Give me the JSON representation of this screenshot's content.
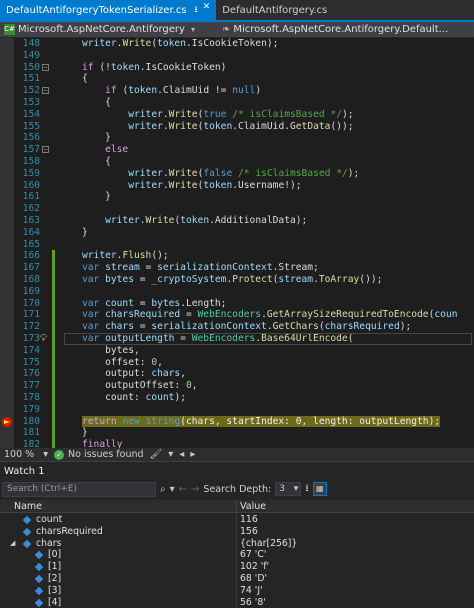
{
  "tabs": [
    {
      "label": "DefaultAntiforgeryTokenSerializer.cs",
      "active": true
    },
    {
      "label": "DefaultAntiforgery.cs",
      "active": false
    }
  ],
  "nav": {
    "project": "Microsoft.AspNetCore.Antiforgery",
    "type": "Microsoft.AspNetCore.Antiforgery.Default..."
  },
  "code_lines": [
    {
      "n": "148",
      "html": "<span class=\"p\">writer</span>.<span class=\"m\">Write</span>(<span class=\"p\">token</span>.IsCookieToken);",
      "indent": 3
    },
    {
      "n": "149",
      "html": "",
      "indent": 0
    },
    {
      "n": "150",
      "html": "<span class=\"ctl\">if</span> (!<span class=\"p\">token</span>.IsCookieToken)",
      "indent": 3
    },
    {
      "n": "151",
      "html": "{",
      "indent": 3
    },
    {
      "n": "152",
      "html": "<span class=\"ctl\">if</span> (<span class=\"p\">token</span>.ClaimUid != <span class=\"k\">null</span>)",
      "indent": 4
    },
    {
      "n": "153",
      "html": "{",
      "indent": 4
    },
    {
      "n": "154",
      "html": "<span class=\"p\">writer</span>.<span class=\"m\">Write</span>(<span class=\"k\">true</span> <span class=\"c\">/* isClaimsBased */</span>);",
      "indent": 5
    },
    {
      "n": "155",
      "html": "<span class=\"p\">writer</span>.<span class=\"m\">Write</span>(<span class=\"p\">token</span>.ClaimUid.<span class=\"m\">GetData</span>());",
      "indent": 5
    },
    {
      "n": "156",
      "html": "}",
      "indent": 4
    },
    {
      "n": "157",
      "html": "<span class=\"ctl\">else</span>",
      "indent": 4
    },
    {
      "n": "158",
      "html": "{",
      "indent": 4
    },
    {
      "n": "159",
      "html": "<span class=\"p\">writer</span>.<span class=\"m\">Write</span>(<span class=\"k\">false</span> <span class=\"c\">/* isClaimsBased */</span>);",
      "indent": 5
    },
    {
      "n": "160",
      "html": "<span class=\"p\">writer</span>.<span class=\"m\">Write</span>(<span class=\"p\">token</span>.Username!);",
      "indent": 5
    },
    {
      "n": "161",
      "html": "}",
      "indent": 4
    },
    {
      "n": "162",
      "html": "",
      "indent": 0
    },
    {
      "n": "163",
      "html": "<span class=\"p\">writer</span>.<span class=\"m\">Write</span>(<span class=\"p\">token</span>.AdditionalData);",
      "indent": 4
    },
    {
      "n": "164",
      "html": "}",
      "indent": 3
    },
    {
      "n": "165",
      "html": "",
      "indent": 0
    },
    {
      "n": "166",
      "html": "<span class=\"p\">writer</span>.<span class=\"m\">Flush</span>();",
      "indent": 3
    },
    {
      "n": "167",
      "html": "<span class=\"k\">var</span> <span class=\"p\">stream</span> = <span class=\"p\">serializationContext</span>.Stream;",
      "indent": 3
    },
    {
      "n": "168",
      "html": "<span class=\"k\">var</span> <span class=\"p\">bytes</span> = <span class=\"p\">_cryptoSystem</span>.<span class=\"m\">Protect</span>(<span class=\"p\">stream</span>.<span class=\"m\">ToArray</span>());",
      "indent": 3
    },
    {
      "n": "169",
      "html": "",
      "indent": 0
    },
    {
      "n": "170",
      "html": "<span class=\"k\">var</span> <span class=\"p\">count</span> = <span class=\"p\">bytes</span>.Length;",
      "indent": 3
    },
    {
      "n": "171",
      "html": "<span class=\"k\">var</span> <span class=\"p\">charsRequired</span> = <span class=\"t\">WebEncoders</span>.<span class=\"m\">GetArraySizeRequiredToEncode</span>(<span class=\"p\">coun</span>",
      "indent": 3
    },
    {
      "n": "172",
      "html": "<span class=\"k\">var</span> <span class=\"p\">chars</span> = <span class=\"p\">serializationContext</span>.<span class=\"m\">GetChars</span>(<span class=\"p\">charsRequired</span>);",
      "indent": 3
    },
    {
      "n": "173",
      "html": "<span class=\"k\">var</span> <span class=\"p\">outputLength</span> = <span class=\"t\">WebEncoders</span>.<span class=\"m\">Base64UrlEncode</span>(",
      "indent": 3
    },
    {
      "n": "174",
      "html": "bytes,",
      "indent": 4
    },
    {
      "n": "175",
      "html": "offset: <span class=\"n\">0</span>,",
      "indent": 4
    },
    {
      "n": "176",
      "html": "output: <span class=\"p\">chars</span>,",
      "indent": 4
    },
    {
      "n": "177",
      "html": "outputOffset: <span class=\"n\">0</span>,",
      "indent": 4
    },
    {
      "n": "178",
      "html": "count: <span class=\"p\">count</span>);",
      "indent": 4
    },
    {
      "n": "179",
      "html": "",
      "indent": 0
    },
    {
      "n": "180",
      "html": "<span class=\"next-stmt\"><span class=\"ctl\">return</span> <span class=\"k\">new</span> <span class=\"k\">string</span>(chars, startIndex: 0, length: outputLength);</span>",
      "indent": 3
    },
    {
      "n": "181",
      "html": "}",
      "indent": 2
    },
    {
      "n": "182",
      "html": "<span class=\"ctl\">finally</span>",
      "indent": 2
    }
  ],
  "status": {
    "zoom": "100 %",
    "issues": "No issues found"
  },
  "watch": {
    "title": "Watch 1",
    "search_placeholder": "Search (Ctrl+E)",
    "depth_label": "Search Depth:",
    "depth_value": "3",
    "col_name": "Name",
    "col_value": "Value",
    "rows": [
      {
        "name": "count",
        "value": "116",
        "level": 1,
        "expandable": false
      },
      {
        "name": "charsRequired",
        "value": "156",
        "level": 1,
        "expandable": false
      },
      {
        "name": "chars",
        "value": "{char[256]}",
        "level": 1,
        "expandable": true
      },
      {
        "name": "[0]",
        "value": "67 'C'",
        "level": 2,
        "expandable": false
      },
      {
        "name": "[1]",
        "value": "102 'f'",
        "level": 2,
        "expandable": false
      },
      {
        "name": "[2]",
        "value": "68 'D'",
        "level": 2,
        "expandable": false
      },
      {
        "name": "[3]",
        "value": "74 'J'",
        "level": 2,
        "expandable": false
      },
      {
        "name": "[4]",
        "value": "56 '8'",
        "level": 2,
        "expandable": false
      }
    ]
  },
  "colors": {
    "accent": "#007acc",
    "editor_bg": "#1e1e1e",
    "keyword": "#569cd6",
    "control": "#d8a0df",
    "method": "#dcdcaa",
    "type": "#4ec9b0",
    "comment": "#57a64a",
    "next_statement": "#6b6b1a"
  }
}
